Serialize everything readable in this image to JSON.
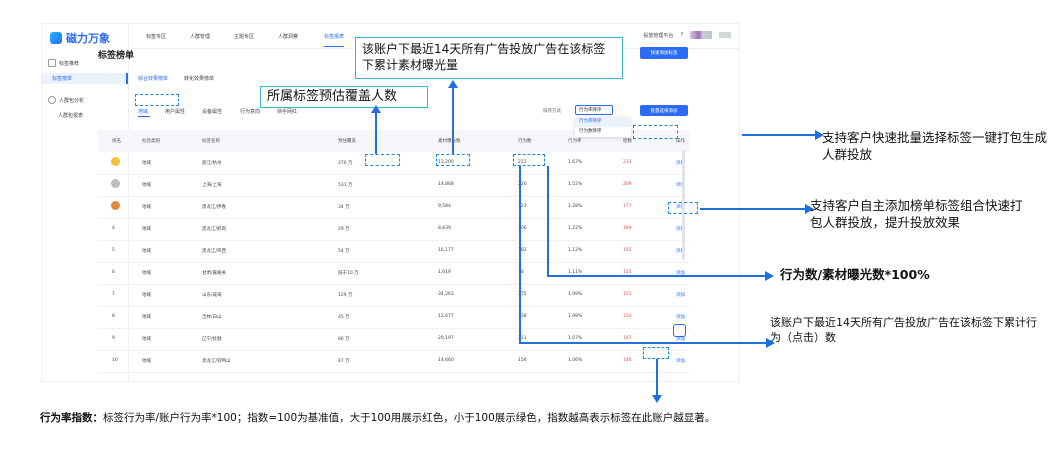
{
  "app": {
    "logo": "磁力万象",
    "sidebar": [
      {
        "label": "标签推荐",
        "icon": "grid-icon",
        "active": false
      },
      {
        "label": "标签榜单",
        "icon": "",
        "active": true
      },
      {
        "label": "人群包分析",
        "icon": "users-icon",
        "active": false
      },
      {
        "label": "人群包报表",
        "icon": "",
        "active": false
      }
    ],
    "nav": [
      "标签专区",
      "人群管理",
      "主题专区",
      "人群洞察",
      "标签报表"
    ],
    "top_right": {
      "ad_platform": "投放管理平台"
    }
  },
  "page": {
    "title": "标签榜单",
    "quick_add_button": "快速添加标签",
    "list_tabs": [
      "综合效果榜单",
      "转化效果榜单"
    ],
    "category_tabs": [
      "地域",
      "用户属性",
      "设备属性",
      "行为意向",
      "快手网红"
    ],
    "sort_label": "排序方式",
    "sort_value": "行为率降序",
    "sort_options": [
      "行为率降序",
      "行为数降序"
    ],
    "batch_button": "批量选择添加",
    "columns": [
      "排名",
      "标签类别",
      "标签名称",
      "预估覆盖",
      "素材曝光数",
      "行为数",
      "行为率",
      "指数",
      "操作"
    ],
    "rows": [
      {
        "rank": "",
        "medal": "gold",
        "category": "地域",
        "name": "浙江/杭州",
        "coverage": "276 万",
        "exposure": "13,200",
        "actions": "221",
        "rate": "1.67%",
        "index": "231",
        "op": "添加"
      },
      {
        "rank": "",
        "medal": "silver",
        "category": "地域",
        "name": "上海/上海",
        "coverage": "531 万",
        "exposure": "14,868",
        "actions": "226",
        "rate": "1.52%",
        "index": "209",
        "op": "添加"
      },
      {
        "rank": "",
        "medal": "bronze",
        "category": "地域",
        "name": "黑龙江/伊春",
        "coverage": "34 万",
        "exposure": "9,584",
        "actions": "123",
        "rate": "1.28%",
        "index": "177",
        "op": "添加"
      },
      {
        "rank": "4",
        "medal": "",
        "category": "地域",
        "name": "黑龙江/鹤岗",
        "coverage": "29 万",
        "exposure": "8,639",
        "actions": "106",
        "rate": "1.22%",
        "index": "169",
        "op": "添加"
      },
      {
        "rank": "5",
        "medal": "",
        "category": "地域",
        "name": "黑龙江/鸡西",
        "coverage": "54 万",
        "exposure": "16,177",
        "actions": "182",
        "rate": "1.12%",
        "index": "155",
        "op": "添加"
      },
      {
        "rank": "6",
        "medal": "",
        "category": "地域",
        "name": "甘肃/嘉峪关",
        "coverage": "低于10 万",
        "exposure": "1,619",
        "actions": "18",
        "rate": "1.11%",
        "index": "153",
        "op": "添加"
      },
      {
        "rank": "7",
        "medal": "",
        "category": "地域",
        "name": "山东/威海",
        "coverage": "129 万",
        "exposure": "34,263",
        "actions": "375",
        "rate": "1.09%",
        "index": "151",
        "op": "添加"
      },
      {
        "rank": "8",
        "medal": "",
        "category": "地域",
        "name": "吉林/白山",
        "coverage": "45 万",
        "exposure": "12,677",
        "actions": "138",
        "rate": "1.09%",
        "index": "150",
        "op": "添加"
      },
      {
        "rank": "9",
        "medal": "",
        "category": "地域",
        "name": "辽宁/抚顺",
        "coverage": "86 万",
        "exposure": "29,197",
        "actions": "311",
        "rate": "1.07%",
        "index": "147",
        "op": "添加"
      },
      {
        "rank": "10",
        "medal": "",
        "category": "地域",
        "name": "黑龙江/双鸭山",
        "coverage": "47 万",
        "exposure": "14,660",
        "actions": "156",
        "rate": "1.06%",
        "index": "146",
        "op": "添加"
      }
    ]
  },
  "annotations": {
    "exposure_note": "该账户下最近14天所有广告投放广告在该标签下累计素材曝光量",
    "coverage_note": "所属标签预估覆盖人数",
    "batch_note": "支持客户快速批量选择标签一键打包生成人群投放",
    "add_note": "支持客户自主添加榜单标签组合快速打包人群投放，提升投放效果",
    "rate_note": "行为数/素材曝光数*100%",
    "actions_note": "该账户下最近14天所有广告投放广告在该标签下累计行为（点击）数",
    "index_title": "行为率指数：",
    "index_body": "标签行为率/账户行为率*100；指数=100为基准值，大于100用展示红色，小于100展示绿色，指数越高表示标签在此账户越显著。"
  },
  "colors": {
    "accent": "#2a6df4",
    "index_red": "#e24a4a",
    "arrow": "#1f6fe0"
  }
}
